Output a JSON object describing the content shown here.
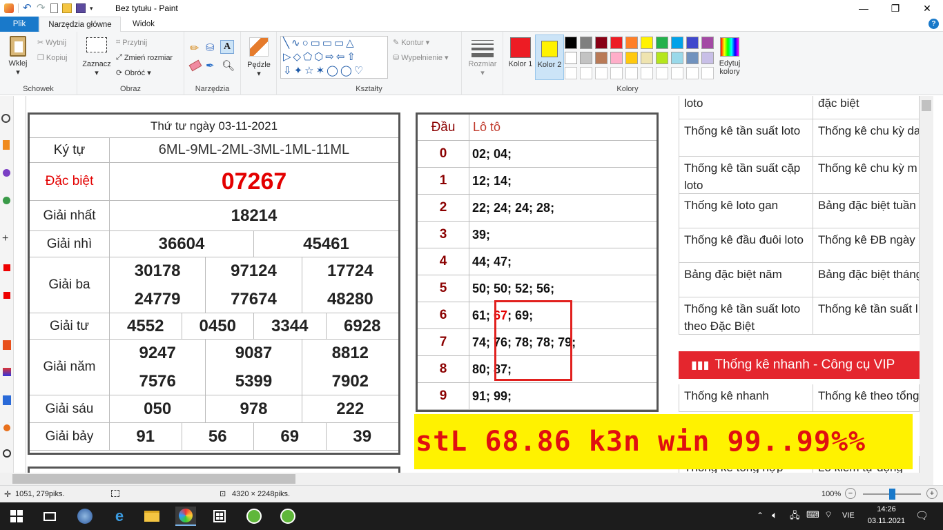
{
  "window": {
    "title": "Bez tytułu - Paint"
  },
  "tabs": [
    {
      "label": "Plik"
    },
    {
      "label": "Narzędzia główne"
    },
    {
      "label": "Widok"
    }
  ],
  "ribbon": {
    "clipboard": {
      "label": "Schowek",
      "paste": "Wklej",
      "cut": "Wytnij",
      "copy": "Kopiuj"
    },
    "image": {
      "label": "Obraz",
      "select": "Zaznacz",
      "crop": "Przytnij",
      "resize": "Zmień rozmiar",
      "rotate": "Obróć"
    },
    "tools": {
      "label": "Narzędzia"
    },
    "brushes": {
      "label": "Pędzle"
    },
    "shapes": {
      "label": "Kształty",
      "outline": "Kontur",
      "fill": "Wypełnienie"
    },
    "size": {
      "label": "Rozmiar"
    },
    "colors": {
      "label": "Kolory",
      "color1": "Kolor 1",
      "color2": "Kolor 2",
      "edit": "Edytuj kolory"
    }
  },
  "palette": {
    "color1": "#ed1c24",
    "color2": "#fff200",
    "row1": [
      "#000000",
      "#7f7f7f",
      "#880015",
      "#ed1c24",
      "#ff7f27",
      "#fff200",
      "#22b14c",
      "#00a2e8",
      "#3f48cc",
      "#a349a4"
    ],
    "row2": [
      "#ffffff",
      "#c3c3c3",
      "#b97a57",
      "#ffaec9",
      "#ffc90e",
      "#efe4b0",
      "#b5e61d",
      "#99d9ea",
      "#7092be",
      "#c8bfe7"
    ]
  },
  "results": {
    "date": "Thứ tư ngày 03-11-2021",
    "kytu_label": "Ký tự",
    "kytu_value": "6ML-9ML-2ML-3ML-1ML-11ML",
    "prizes": [
      {
        "label": "Đặc biệt",
        "rows": [
          [
            "07267"
          ]
        ]
      },
      {
        "label": "Giải nhất",
        "rows": [
          [
            "18214"
          ]
        ]
      },
      {
        "label": "Giải nhì",
        "rows": [
          [
            "36604",
            "45461"
          ]
        ]
      },
      {
        "label": "Giải ba",
        "rows": [
          [
            "30178",
            "97124",
            "17724"
          ],
          [
            "24779",
            "77674",
            "48280"
          ]
        ]
      },
      {
        "label": "Giải tư",
        "rows": [
          [
            "4552",
            "0450",
            "3344",
            "6928"
          ]
        ]
      },
      {
        "label": "Giải năm",
        "rows": [
          [
            "9247",
            "9087",
            "8812"
          ],
          [
            "7576",
            "5399",
            "7902"
          ]
        ]
      },
      {
        "label": "Giải sáu",
        "rows": [
          [
            "050",
            "978",
            "222"
          ]
        ]
      },
      {
        "label": "Giải bảy",
        "rows": [
          [
            "91",
            "56",
            "69",
            "39"
          ]
        ]
      }
    ]
  },
  "loto": {
    "head_label": "Đầu",
    "loto_label": "Lô tô",
    "rows": [
      {
        "dau": "0",
        "values": "02; 04;"
      },
      {
        "dau": "1",
        "values": "12; 14;"
      },
      {
        "dau": "2",
        "values": "22; 24; 24; 28;"
      },
      {
        "dau": "3",
        "values": "39;"
      },
      {
        "dau": "4",
        "values": "44; 47;"
      },
      {
        "dau": "5",
        "values": "50; 50; 52; 56;"
      },
      {
        "dau": "6",
        "pre": "61; ",
        "hl": "67",
        "post": "; 69;"
      },
      {
        "dau": "7",
        "values": "74; 76; 78; 78; 79;"
      },
      {
        "dau": "8",
        "values": "80; 87;"
      },
      {
        "dau": "9",
        "values": "91; 99;"
      }
    ]
  },
  "links": [
    [
      "loto",
      "đặc biệt"
    ],
    [
      "Thống kê tần suất loto",
      "Thống kê chu kỳ da loto"
    ],
    [
      "Thống kê tần suất cặp loto",
      "Thống kê chu kỳ m dàn cùng về"
    ],
    [
      "Thống kê loto gan",
      "Bảng đặc biệt tuần"
    ],
    [
      "Thống kê đầu đuôi loto",
      "Thống kê ĐB ngày"
    ],
    [
      "Bảng đặc biệt năm",
      "Bảng đặc biệt tháng"
    ],
    [
      "Thống kê tần suất loto theo Đặc Biệt",
      "Thống kê tần suất l theo loto"
    ]
  ],
  "vip": {
    "header": "Thống kê nhanh - Công cụ VIP",
    "links": [
      [
        "Thống kê nhanh",
        "Thống kê theo tổng"
      ]
    ],
    "partial": [
      "Thống kê tổng hợp",
      "Lô kiểm tự động"
    ]
  },
  "banner": {
    "text": "stL 68.86 k3n win 99..99%%"
  },
  "status": {
    "cursor": "1051, 279piks.",
    "size": "4320 × 2248piks.",
    "zoom": "100%"
  },
  "taskbar": {
    "time": "14:26",
    "date": "03.11.2021",
    "lang": "VIE"
  }
}
